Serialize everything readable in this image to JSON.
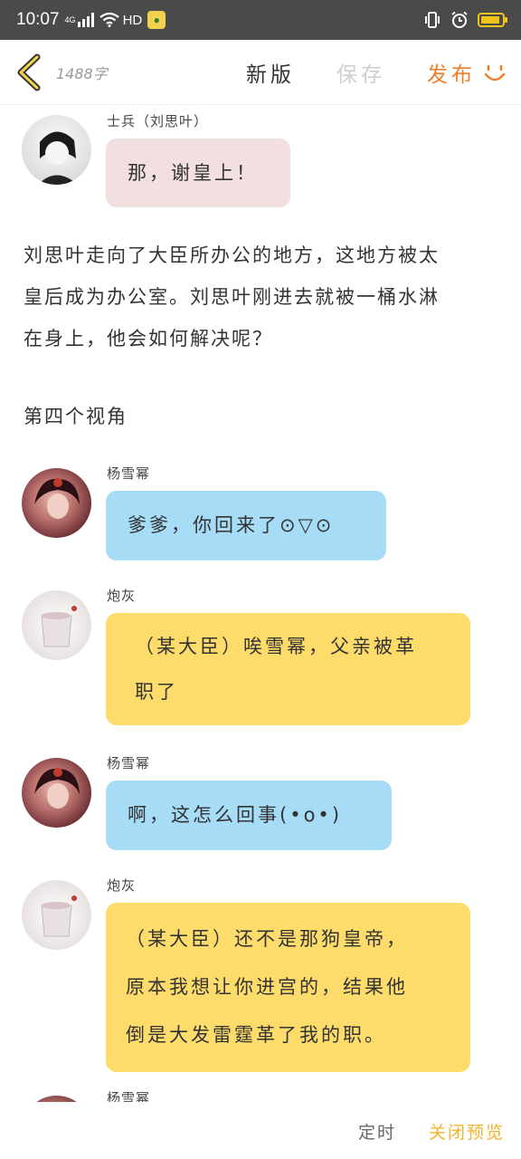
{
  "status_bar": {
    "time": "10:07",
    "network": "4G",
    "hd": "HD",
    "battery_level": 0.9,
    "icons": [
      "signal-icon",
      "wifi-icon",
      "app-icon",
      "vibrate-icon",
      "alarm-icon",
      "battery-icon"
    ]
  },
  "toolbar": {
    "word_count": "1488字",
    "new_version": "新版",
    "save": "保存",
    "publish": "发布",
    "colors": {
      "publish": "#f07f2a",
      "save_disabled": "#cfcfcf"
    }
  },
  "messages": [
    {
      "speaker": "士兵（刘思叶）",
      "text": "那，谢皇上！",
      "color": "#f2dfe0"
    },
    {
      "speaker": "杨雪幂",
      "text": "爹爹，你回来了⊙▽⊙",
      "color": "#a6dcf6"
    },
    {
      "speaker": "炮灰",
      "lines": [
        "（某大臣）唉雪幂，父亲被革",
        "职了"
      ],
      "color": "#fedc6c"
    },
    {
      "speaker": "杨雪幂",
      "text": "啊，这怎么回事(•ο•)",
      "color": "#a6dcf6"
    },
    {
      "speaker": "炮灰",
      "lines": [
        "（某大臣）还不是那狗皇帝，",
        "原本我想让你进宫的，结果他",
        "倒是大发雷霆革了我的职。"
      ],
      "color": "#fedc6c"
    },
    {
      "speaker": "杨雪幂"
    }
  ],
  "narration": {
    "lines": [
      "刘思叶走向了大臣所办公的地方，这地方被太",
      "皇后成为办公室。刘思叶刚进去就被一桶水淋",
      "在身上，他会如何解决呢？"
    ],
    "section_title": "第四个视角"
  },
  "bottom_bar": {
    "schedule": "定时",
    "close_preview": "关闭预览",
    "colors": {
      "close_preview": "#f2b32a"
    }
  }
}
